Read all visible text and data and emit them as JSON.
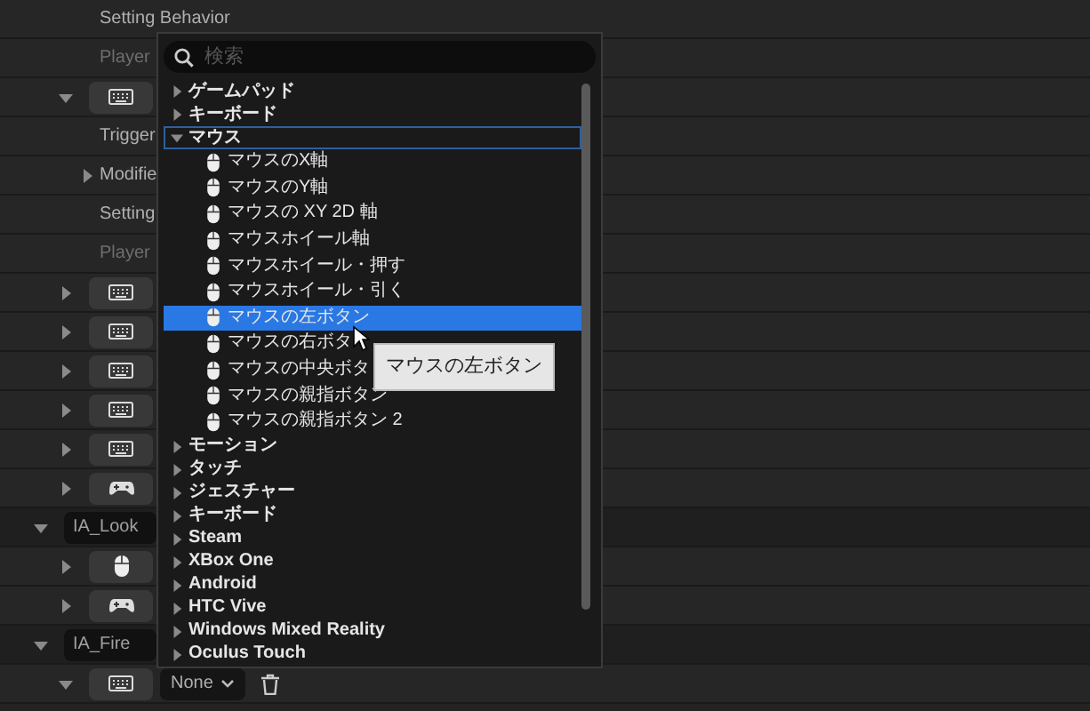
{
  "rows": [
    {
      "kind": "label",
      "label": "Setting Behavior",
      "dim": false
    },
    {
      "kind": "label",
      "label": "Player",
      "dim": true
    },
    {
      "kind": "keyboard",
      "expanded": true
    },
    {
      "kind": "label",
      "label": "Trigger",
      "dim": false
    },
    {
      "kind": "group",
      "label": "Modifie",
      "expanded": false
    },
    {
      "kind": "label",
      "label": "Setting",
      "dim": false
    },
    {
      "kind": "label",
      "label": "Player",
      "dim": true
    },
    {
      "kind": "keyboard",
      "expanded": false
    },
    {
      "kind": "keyboard",
      "expanded": false
    },
    {
      "kind": "keyboard",
      "expanded": false
    },
    {
      "kind": "keyboard",
      "expanded": false
    },
    {
      "kind": "keyboard",
      "expanded": false
    },
    {
      "kind": "gamepad",
      "expanded": false
    },
    {
      "kind": "action",
      "label": "IA_Look",
      "expanded": true
    },
    {
      "kind": "mouse",
      "expanded": false
    },
    {
      "kind": "gamepad",
      "expanded": false
    },
    {
      "kind": "action",
      "label": "IA_Fire",
      "expanded": true
    },
    {
      "kind": "keyboard",
      "expanded": true,
      "dropdown": "None"
    }
  ],
  "picker": {
    "search": {
      "placeholder": "検索"
    },
    "items": [
      {
        "label": "ゲームパッド",
        "expanded": false,
        "focused": false,
        "selected": false
      },
      {
        "label": "キーボード",
        "expanded": false,
        "focused": false,
        "selected": false
      },
      {
        "label": "マウス",
        "expanded": true,
        "focused": true,
        "selected": false,
        "children": [
          {
            "label": "マウスのX軸",
            "selected": false
          },
          {
            "label": "マウスのY軸",
            "selected": false
          },
          {
            "label": "マウスの XY 2D 軸",
            "selected": false
          },
          {
            "label": "マウスホイール軸",
            "selected": false
          },
          {
            "label": "マウスホイール・押す",
            "selected": false
          },
          {
            "label": "マウスホイール・引く",
            "selected": false
          },
          {
            "label": "マウスの左ボタン",
            "selected": true
          },
          {
            "label": "マウスの右ボタ",
            "selected": false
          },
          {
            "label": "マウスの中央ボタ",
            "selected": false
          },
          {
            "label": "マウスの親指ボタン",
            "selected": false
          },
          {
            "label": "マウスの親指ボタン 2",
            "selected": false
          }
        ]
      },
      {
        "label": "モーション",
        "expanded": false,
        "focused": false,
        "selected": false
      },
      {
        "label": "タッチ",
        "expanded": false,
        "focused": false,
        "selected": false
      },
      {
        "label": "ジェスチャー",
        "expanded": false,
        "focused": false,
        "selected": false
      },
      {
        "label": "キーボード",
        "expanded": false,
        "focused": false,
        "selected": false
      },
      {
        "label": "Steam",
        "expanded": false,
        "focused": false,
        "selected": false
      },
      {
        "label": "XBox One",
        "expanded": false,
        "focused": false,
        "selected": false
      },
      {
        "label": "Android",
        "expanded": false,
        "focused": false,
        "selected": false
      },
      {
        "label": "HTC Vive",
        "expanded": false,
        "focused": false,
        "selected": false
      },
      {
        "label": "Windows Mixed Reality",
        "expanded": false,
        "focused": false,
        "selected": false
      },
      {
        "label": "Oculus Touch",
        "expanded": false,
        "focused": false,
        "selected": false
      }
    ]
  },
  "tooltip": "マウスの左ボタン"
}
